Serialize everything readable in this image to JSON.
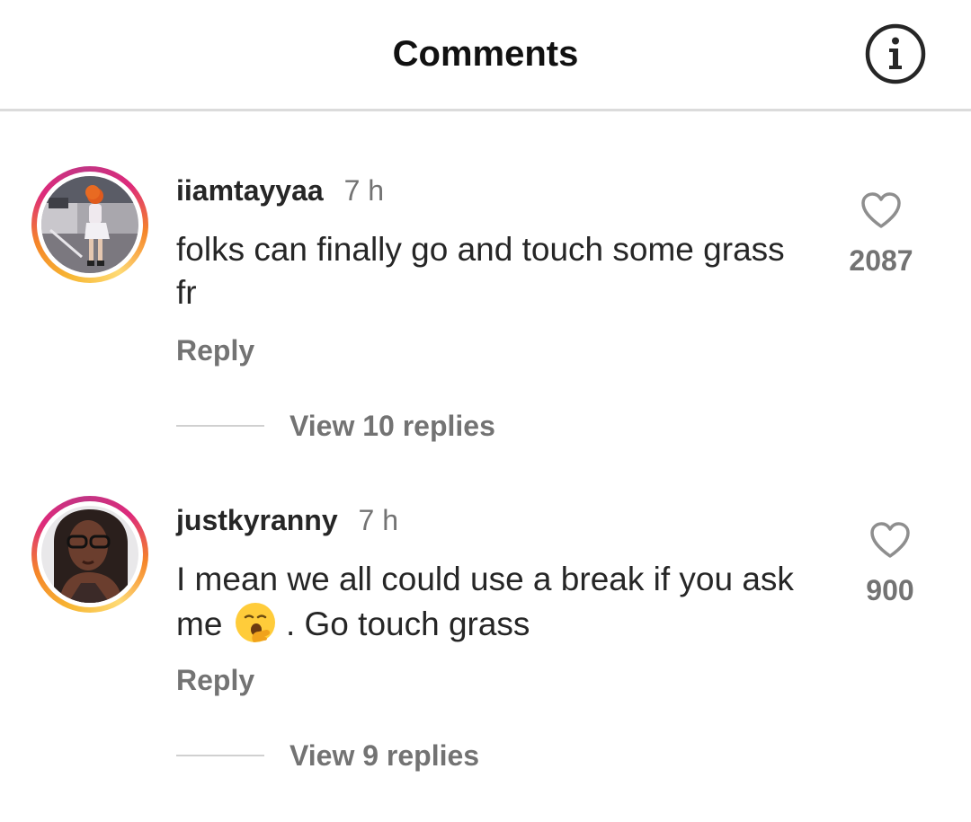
{
  "header": {
    "title": "Comments",
    "info_icon": "info-icon"
  },
  "comments": [
    {
      "username": "iiamtayyaa",
      "time": "7 h",
      "text": "folks can finally go and touch some grass fr",
      "reply_label": "Reply",
      "view_replies": "View 10 replies",
      "likes": "2087",
      "avatar": "user-photo-standing"
    },
    {
      "username": "justkyranny",
      "time": "7 h",
      "text_before_emoji": "I mean we all could use a break if you ask me",
      "emoji": "yawning-face-emoji",
      "text_after_emoji": ". Go touch grass",
      "reply_label": "Reply",
      "view_replies": "View 9 replies",
      "likes": "900",
      "avatar": "user-photo-portrait"
    }
  ],
  "colors": {
    "story_ring": [
      "#feda75",
      "#f58529",
      "#dd2a7b",
      "#c13584"
    ],
    "secondary_text": "#737373",
    "divider": "#dbdbdb"
  }
}
